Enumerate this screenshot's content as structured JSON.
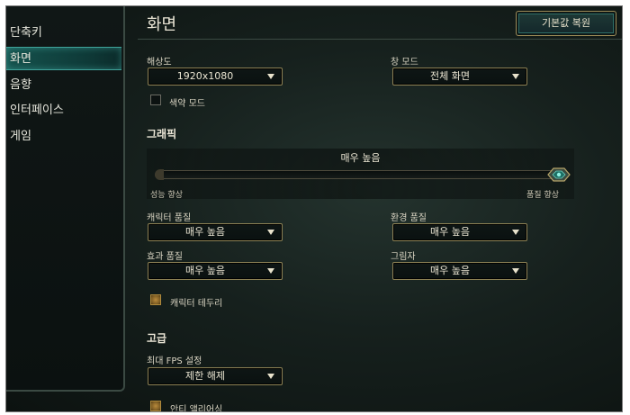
{
  "sidebar": {
    "items": [
      {
        "label": "단축키",
        "active": false
      },
      {
        "label": "화면",
        "active": true
      },
      {
        "label": "음향",
        "active": false
      },
      {
        "label": "인터페이스",
        "active": false
      },
      {
        "label": "게임",
        "active": false
      }
    ]
  },
  "header": {
    "title": "화면",
    "reset_label": "기본값 복원"
  },
  "display": {
    "resolution_label": "해상도",
    "resolution_value": "1920x1080",
    "window_mode_label": "창 모드",
    "window_mode_value": "전체 화면",
    "colorblind_label": "색약 모드",
    "colorblind_checked": false
  },
  "graphics": {
    "section_title": "그래픽",
    "preset_value": "매우 높음",
    "preset_level": 1.0,
    "slider_min_label": "성능 향상",
    "slider_max_label": "품질 향상",
    "character_quality_label": "캐릭터 품질",
    "character_quality_value": "매우 높음",
    "environment_quality_label": "환경 품질",
    "environment_quality_value": "매우 높음",
    "effects_quality_label": "효과 품질",
    "effects_quality_value": "매우 높음",
    "shadows_label": "그림자",
    "shadows_value": "매우 높음",
    "character_outline_label": "캐릭터 테두리",
    "character_outline_checked": true
  },
  "advanced": {
    "section_title": "고급",
    "max_fps_label": "최대 FPS 설정",
    "max_fps_value": "제한 해제",
    "antialiasing_label": "안티 앨리어싱",
    "antialiasing_checked": true
  },
  "colors": {
    "accent_teal": "#15524d",
    "gold_border": "#8d8255",
    "background": "#16201d"
  },
  "icons": {
    "dropdown": "chevron-down-icon",
    "slider_handle": "gem-handle-icon"
  }
}
